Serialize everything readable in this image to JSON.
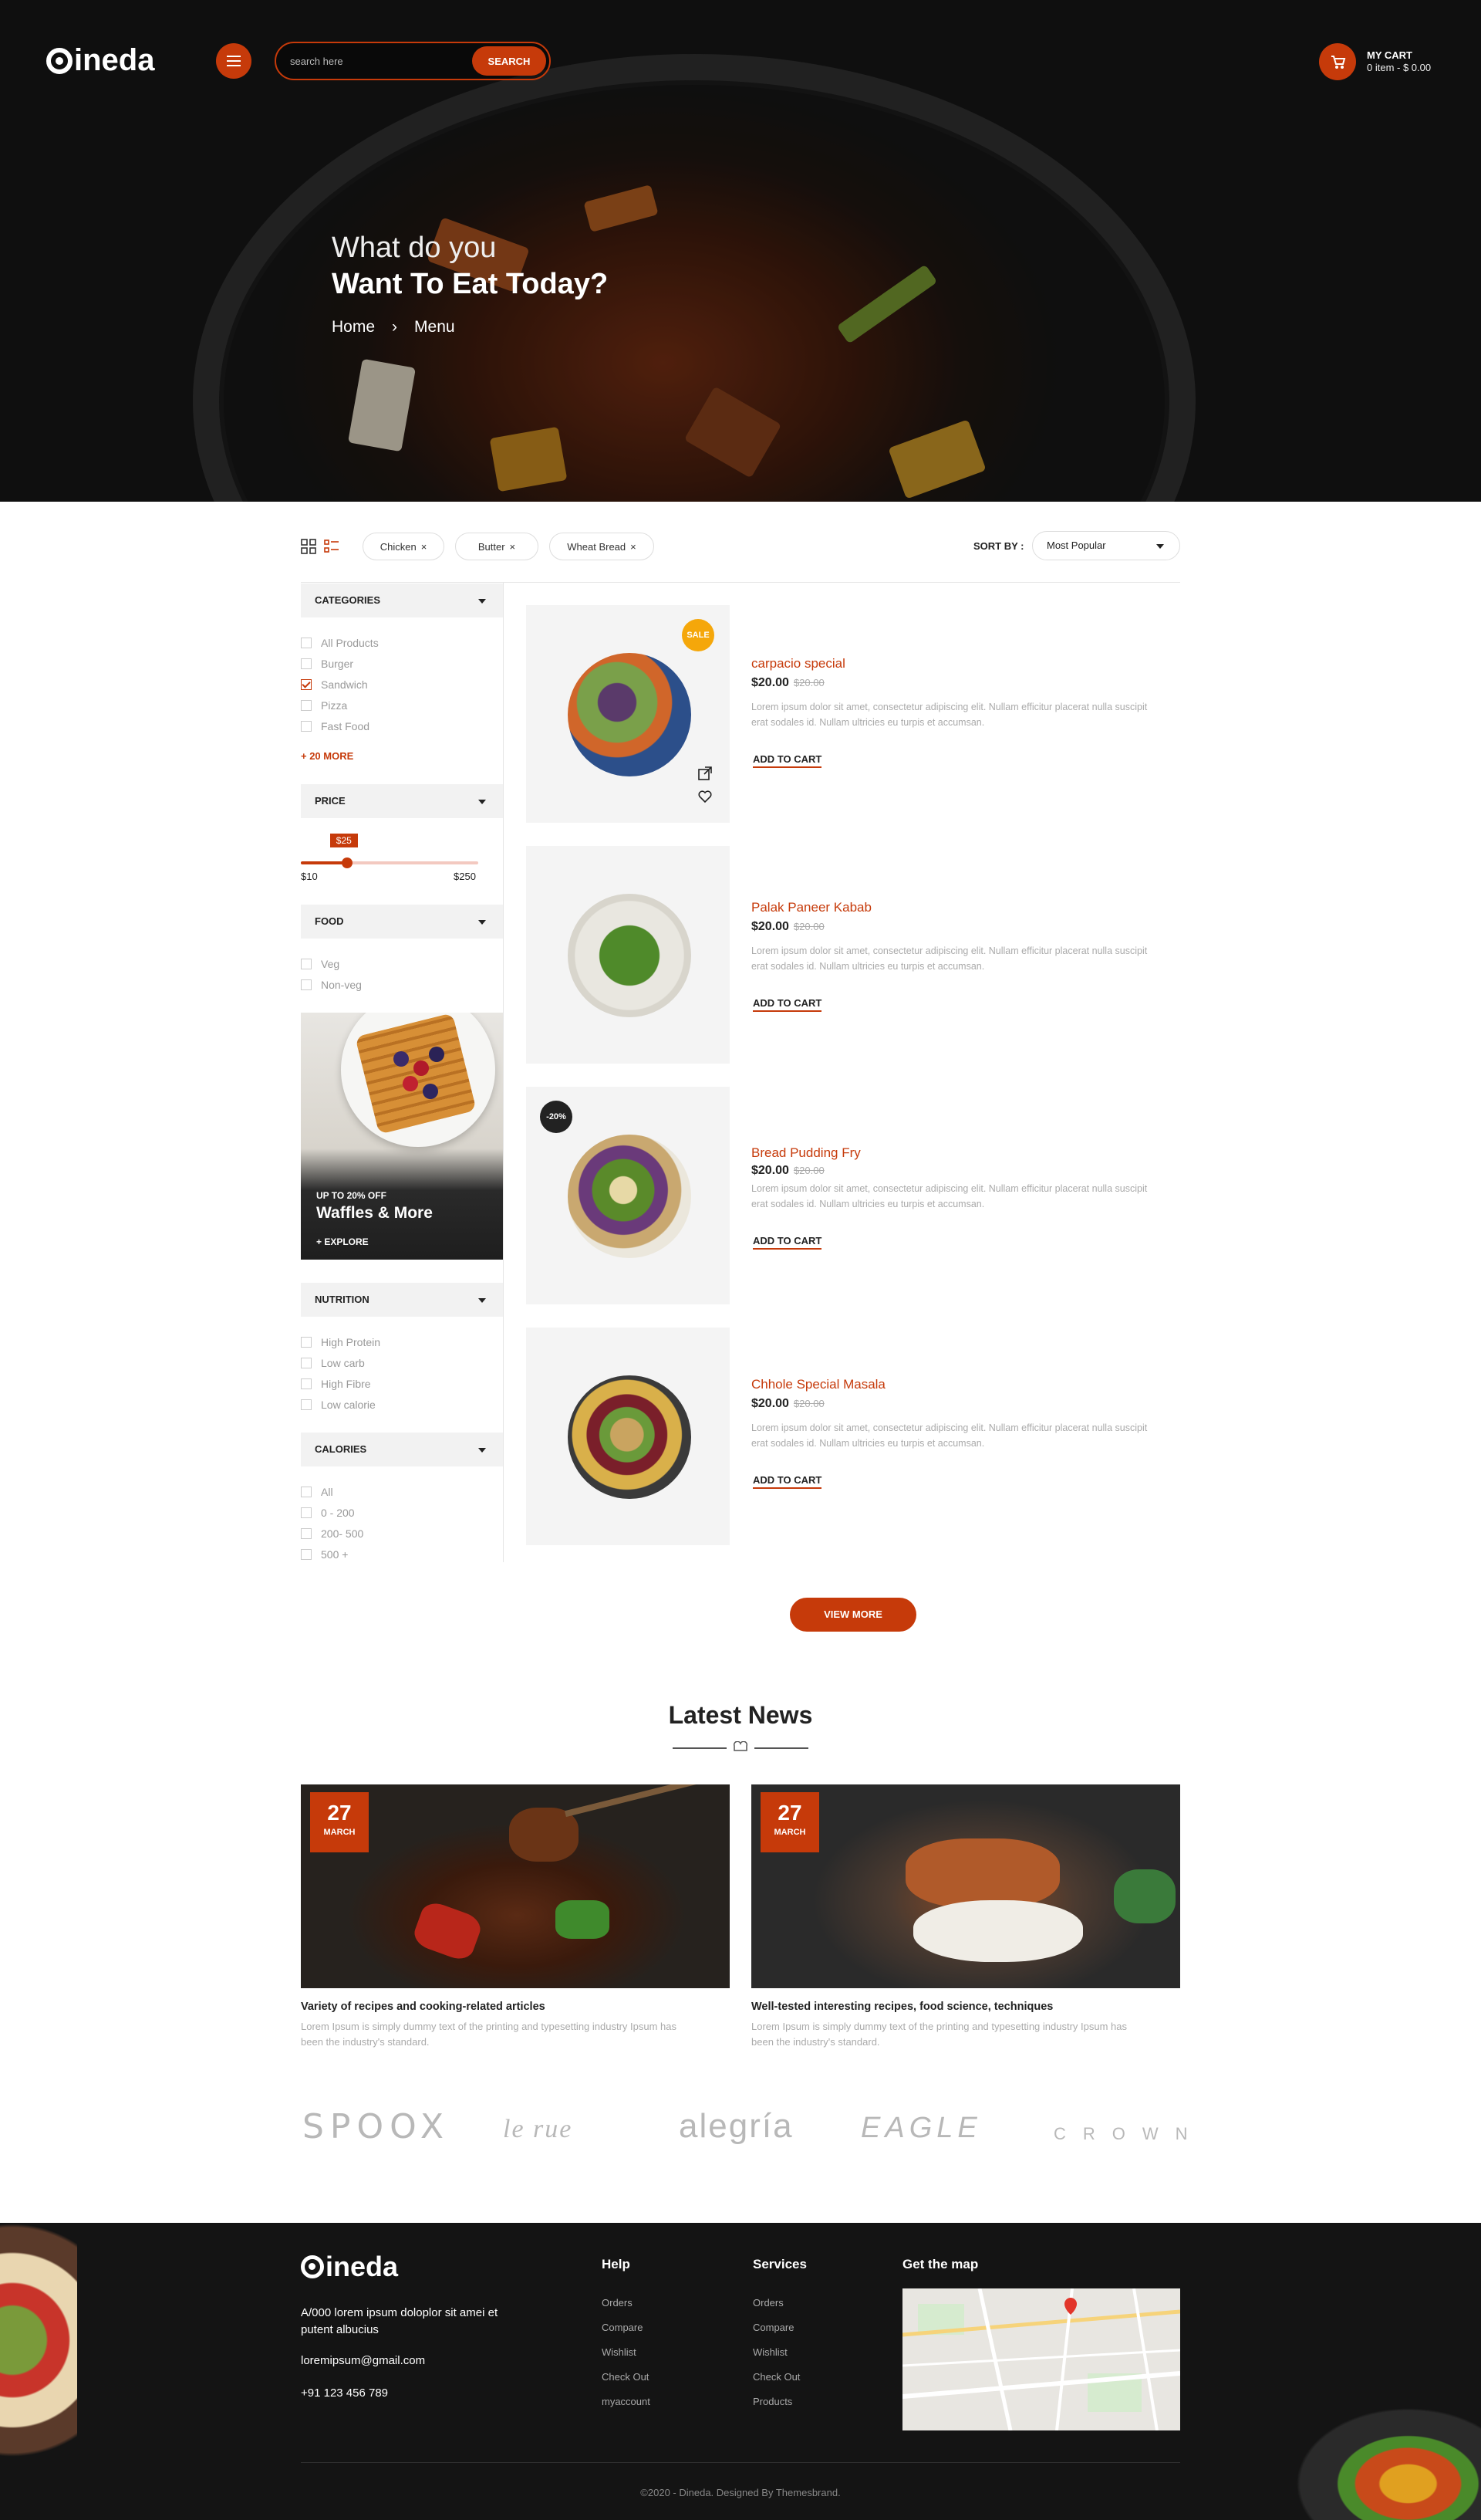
{
  "header": {
    "logo_text": "ineda",
    "search_placeholder": "search here",
    "search_button": "SEARCH",
    "cart_title": "MY CART",
    "cart_summary": "0 item - $ 0.00"
  },
  "hero": {
    "line1": "What do you",
    "line2": "Want To Eat Today?",
    "breadcrumb_home": "Home",
    "breadcrumb_sep": "›",
    "breadcrumb_current": "Menu"
  },
  "toolbar": {
    "chips": [
      "Chicken",
      "Butter",
      "Wheat Bread"
    ],
    "sort_label": "SORT BY :",
    "sort_value": "Most Popular"
  },
  "sidebar": {
    "categories_title": "CATEGORIES",
    "categories": [
      "All Products",
      "Burger",
      "Sandwich",
      "Pizza",
      "Fast Food"
    ],
    "categories_checked_index": 2,
    "more_link": "+ 20 MORE",
    "price_title": "PRICE",
    "price_current": "$25",
    "price_min": "$10",
    "price_max": "$250",
    "price_fraction": 0.26,
    "food_title": "FOOD",
    "food": [
      "Veg",
      "Non-veg"
    ],
    "promo_small": "UP TO 20% OFF",
    "promo_title": "Waffles & More",
    "promo_link": "+ EXPLORE",
    "nutrition_title": "NUTRITION",
    "nutrition": [
      "High Protein",
      "Low carb",
      "High Fibre",
      "Low calorie"
    ],
    "calories_title": "CALORIES",
    "calories": [
      "All",
      "0 - 200",
      "200- 500",
      "500 +"
    ]
  },
  "products": [
    {
      "name": "carpacio special",
      "price": "$20.00",
      "old_price": "$20.00",
      "badge": "SALE",
      "desc": "Lorem ipsum dolor sit amet, consectetur adipiscing elit. Nullam efficitur placerat nulla suscipit erat sodales id. Nullam ultricies eu turpis et accumsan.",
      "cta": "ADD TO CART"
    },
    {
      "name": "Palak Paneer Kabab",
      "price": "$20.00",
      "old_price": "$20.00",
      "badge": "",
      "desc": "Lorem ipsum dolor sit amet, consectetur adipiscing elit. Nullam efficitur placerat nulla suscipit erat sodales id. Nullam ultricies eu turpis et accumsan.",
      "cta": "ADD TO CART"
    },
    {
      "name": "Bread Pudding Fry",
      "price": "$20.00",
      "old_price": "$20.00",
      "badge": "-20%",
      "desc": "Lorem ipsum dolor sit amet, consectetur adipiscing elit. Nullam efficitur placerat nulla suscipit erat sodales id. Nullam ultricies eu turpis et accumsan.",
      "cta": "ADD TO CART"
    },
    {
      "name": "Chhole Special Masala",
      "price": "$20.00",
      "old_price": "$20.00",
      "badge": "",
      "desc": "Lorem ipsum dolor sit amet, consectetur adipiscing elit. Nullam efficitur placerat nulla suscipit erat sodales id. Nullam ultricies eu turpis et accumsan.",
      "cta": "ADD TO CART"
    }
  ],
  "view_more": "VIEW MORE",
  "news": {
    "title": "Latest News",
    "cards": [
      {
        "day": "27",
        "month": "MARCH",
        "title": "Variety of recipes and cooking-related articles",
        "desc": "Lorem Ipsum is simply dummy text of the printing and typesetting industry Ipsum has been the industry's standard."
      },
      {
        "day": "27",
        "month": "MARCH",
        "title": "Well-tested interesting recipes, food science, techniques",
        "desc": "Lorem Ipsum is simply dummy text of the printing and typesetting industry Ipsum has been the industry's standard."
      }
    ]
  },
  "brands": [
    "SPOOX",
    "le rue",
    "alegría",
    "EAGLE",
    "CROWN"
  ],
  "footer": {
    "logo_text": "ineda",
    "address": "A/000 lorem ipsum doloplor sit amei et putent albucius",
    "email": "loremipsum@gmail.com",
    "phone": "+91 123 456 789",
    "help_title": "Help",
    "help_links": [
      "Orders",
      "Compare",
      "Wishlist",
      "Check Out",
      "myaccount"
    ],
    "services_title": "Services",
    "services_links": [
      "Orders",
      "Compare",
      "Wishlist",
      "Check Out",
      "Products"
    ],
    "map_title": "Get the map",
    "copyright": "©2020 - Dineda. Designed By Themesbrand."
  },
  "colors": {
    "accent": "#c63a0a",
    "dark": "#141414"
  }
}
